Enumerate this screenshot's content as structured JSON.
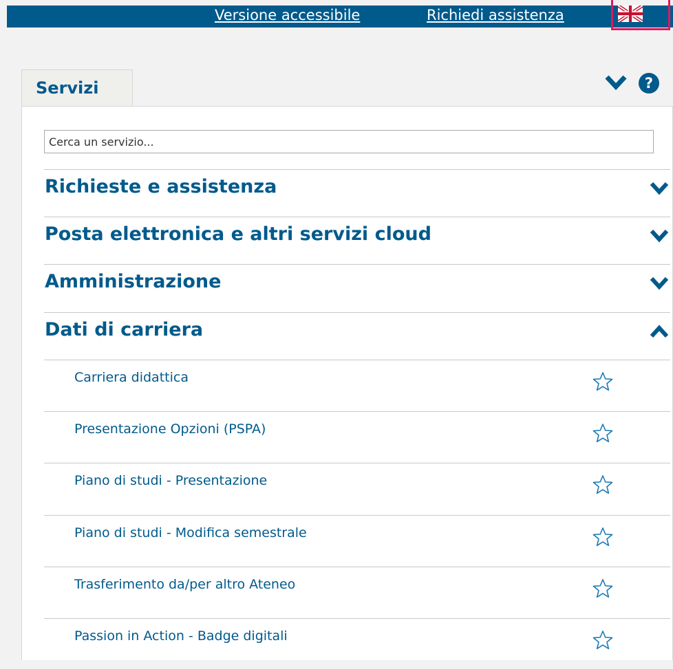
{
  "topbar": {
    "accessible_link": "Versione accessibile",
    "help_link": "Richiedi assistenza",
    "language_icon": "uk-flag-icon"
  },
  "tab": {
    "label": "Servizi"
  },
  "search": {
    "placeholder": "Cerca un servizio..."
  },
  "categories": [
    {
      "label": "Richieste e assistenza",
      "state": "collapsed"
    },
    {
      "label": "Posta elettronica e altri servizi cloud",
      "state": "collapsed"
    },
    {
      "label": "Amministrazione",
      "state": "collapsed"
    },
    {
      "label": "Dati di carriera",
      "state": "expanded"
    }
  ],
  "services": [
    {
      "label": "Carriera didattica"
    },
    {
      "label": "Presentazione Opzioni (PSPA)"
    },
    {
      "label": "Piano di studi - Presentazione"
    },
    {
      "label": "Piano di studi - Modifica semestrale"
    },
    {
      "label": "Trasferimento da/per altro Ateneo"
    },
    {
      "label": "Passion in Action - Badge digitali"
    }
  ],
  "colors": {
    "brand": "#005a8c",
    "highlight": "#d81b60",
    "background": "#f2f2f2",
    "divider": "#c8c8c8"
  }
}
